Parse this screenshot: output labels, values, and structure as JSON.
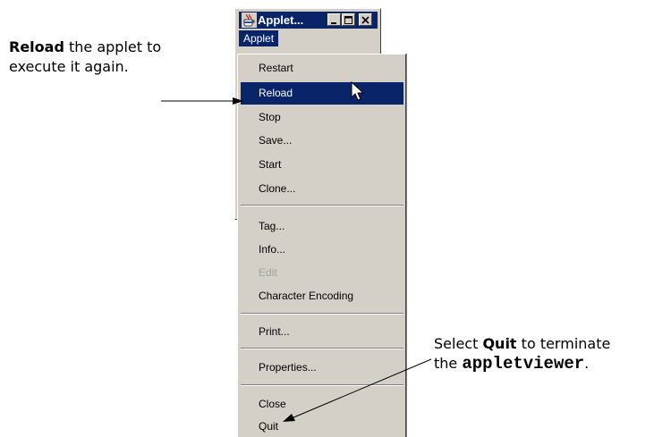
{
  "callouts": {
    "reload": {
      "bold": "Reload",
      "rest_line1": " the applet to",
      "line2": "execute it again."
    },
    "quit": {
      "prefix": "Select ",
      "bold": "Quit",
      "middle": " to terminate",
      "line2_prefix": "the ",
      "mono": "appletviewer",
      "suffix": "."
    }
  },
  "window": {
    "title": "Applet...",
    "app_icon": "java-cup-icon",
    "buttons": {
      "minimize": "minimize-icon",
      "maximize": "maximize-icon",
      "close": "close-icon"
    }
  },
  "menubar": {
    "menu_label": "Applet"
  },
  "menu": {
    "group1": [
      {
        "label": "Restart"
      },
      {
        "label": "Reload",
        "state": "highlighted"
      },
      {
        "label": "Stop"
      },
      {
        "label": "Save..."
      },
      {
        "label": "Start"
      },
      {
        "label": "Clone..."
      }
    ],
    "group2": [
      {
        "label": "Tag..."
      },
      {
        "label": "Info..."
      },
      {
        "label": "Edit",
        "state": "disabled"
      },
      {
        "label": "Character Encoding"
      }
    ],
    "group3": [
      {
        "label": "Print..."
      }
    ],
    "group4": [
      {
        "label": "Properties..."
      }
    ],
    "group5": [
      {
        "label": "Close"
      },
      {
        "label": "Quit"
      }
    ]
  },
  "colors": {
    "selection": "#0a246a",
    "face": "#d4d0c8",
    "disabled_text": "#a0a0a0"
  },
  "cursor": "arrow-cursor-icon"
}
